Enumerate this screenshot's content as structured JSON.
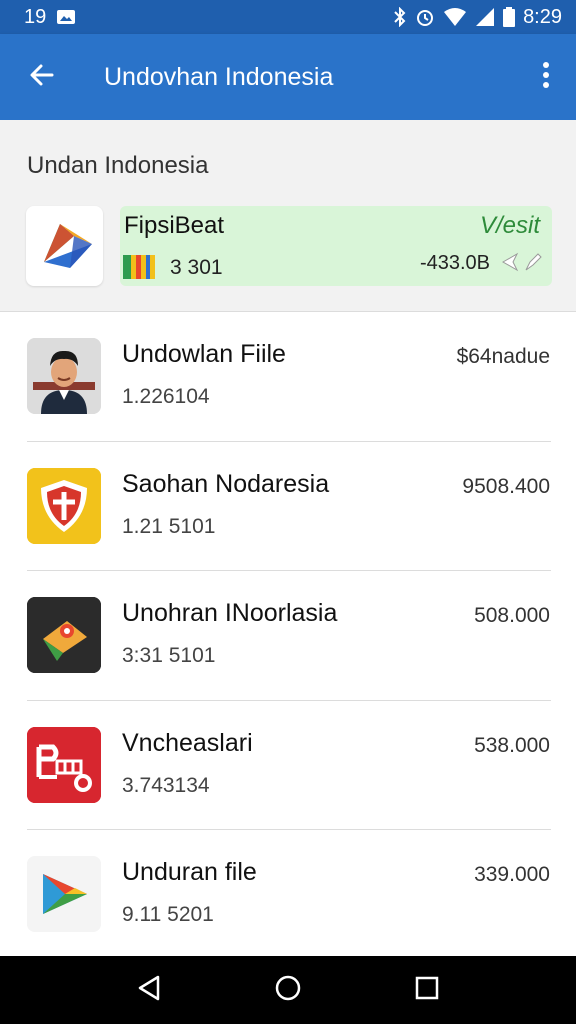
{
  "status_bar": {
    "time_left": "19",
    "clock": "8:29",
    "icons": [
      "gallery-icon",
      "bluetooth-icon",
      "alarm-icon",
      "wifi-icon",
      "signal-icon",
      "battery-icon"
    ]
  },
  "app_bar": {
    "title": "Undovhan Indonesia",
    "back_icon": "arrow-left-icon",
    "menu_icon": "more-vert-icon",
    "color": "#2a73c9"
  },
  "section": {
    "title": "Undan Indonesia"
  },
  "featured": {
    "name": "FipsiBeat",
    "action": "V/esit",
    "count": "3 301",
    "size": "-433.0B",
    "highlight_color": "#d9f5d8"
  },
  "apps": [
    {
      "name": "Undowlan Fiile",
      "subtitle": "1.226104",
      "value": "$64nadue",
      "icon": "person-avatar-icon"
    },
    {
      "name": "Saohan Nodaresia",
      "subtitle": "1.21 5101",
      "value": "9508.400",
      "icon": "shield-icon"
    },
    {
      "name": "Unohran INoorlasia",
      "subtitle": "3:31 5101",
      "value": "508.000",
      "icon": "map-pin-icon"
    },
    {
      "name": "Vncheaslari",
      "subtitle": "3.743134",
      "value": "538.000",
      "icon": "pb-logo-icon"
    },
    {
      "name": "Unduran file",
      "subtitle": "9.11 5201",
      "value": "339.000",
      "icon": "play-store-icon"
    }
  ],
  "nav": {
    "back": "back-triangle-icon",
    "home": "home-circle-icon",
    "recents": "recents-square-icon"
  }
}
